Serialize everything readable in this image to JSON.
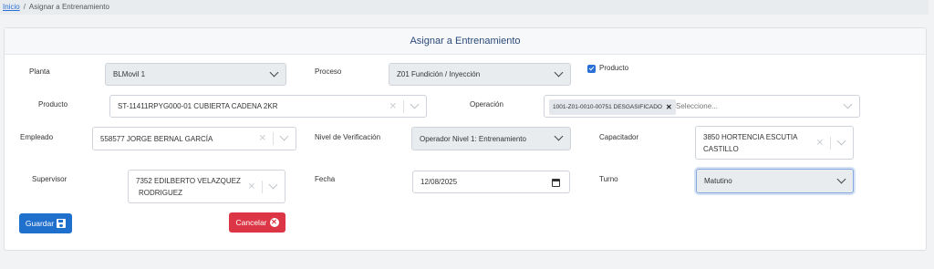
{
  "breadcrumb": {
    "home": "Inicio",
    "separator": "/",
    "current": "Asignar a Entrenamiento"
  },
  "card": {
    "title": "Asignar a Entrenamiento"
  },
  "form": {
    "planta": {
      "label": "Planta",
      "value": "BLMovil 1"
    },
    "proceso": {
      "label": "Proceso",
      "value": "Z01 Fundición / Inyección"
    },
    "producto_check": {
      "label": "Producto",
      "checked": true
    },
    "producto": {
      "label": "Producto",
      "value": "ST-11411RPYG000-01  CUBIERTA CADENA 2KR"
    },
    "operacion": {
      "label": "Operación",
      "tag": "1001-Z01-0010-00751  DESGASIFICADO",
      "placeholder": "Seleccione..."
    },
    "empleado": {
      "label": "Empleado",
      "value": "558577  JORGE   BERNAL  GARCÍA"
    },
    "nivel": {
      "label": "Nivel de Verificación",
      "value": "Operador Nivel 1: Entrenamiento"
    },
    "capacitador": {
      "label": "Capacitador",
      "line1": "3850  HORTENCIA  ESCUTIA",
      "line2": "CASTILLO"
    },
    "supervisor": {
      "label": "Supervisor",
      "line1": "7352   EDILBERTO   VELAZQUEZ",
      "line2": "RODRIGUEZ"
    },
    "fecha": {
      "label": "Fecha",
      "value": "12/08/2025"
    },
    "turno": {
      "label": "Turno",
      "value": "Matutino"
    }
  },
  "buttons": {
    "save": "Guardar",
    "cancel": "Cancelar"
  },
  "colors": {
    "primary": "#1f6fcc",
    "danger": "#dc3545",
    "link": "#2a6fd6"
  }
}
